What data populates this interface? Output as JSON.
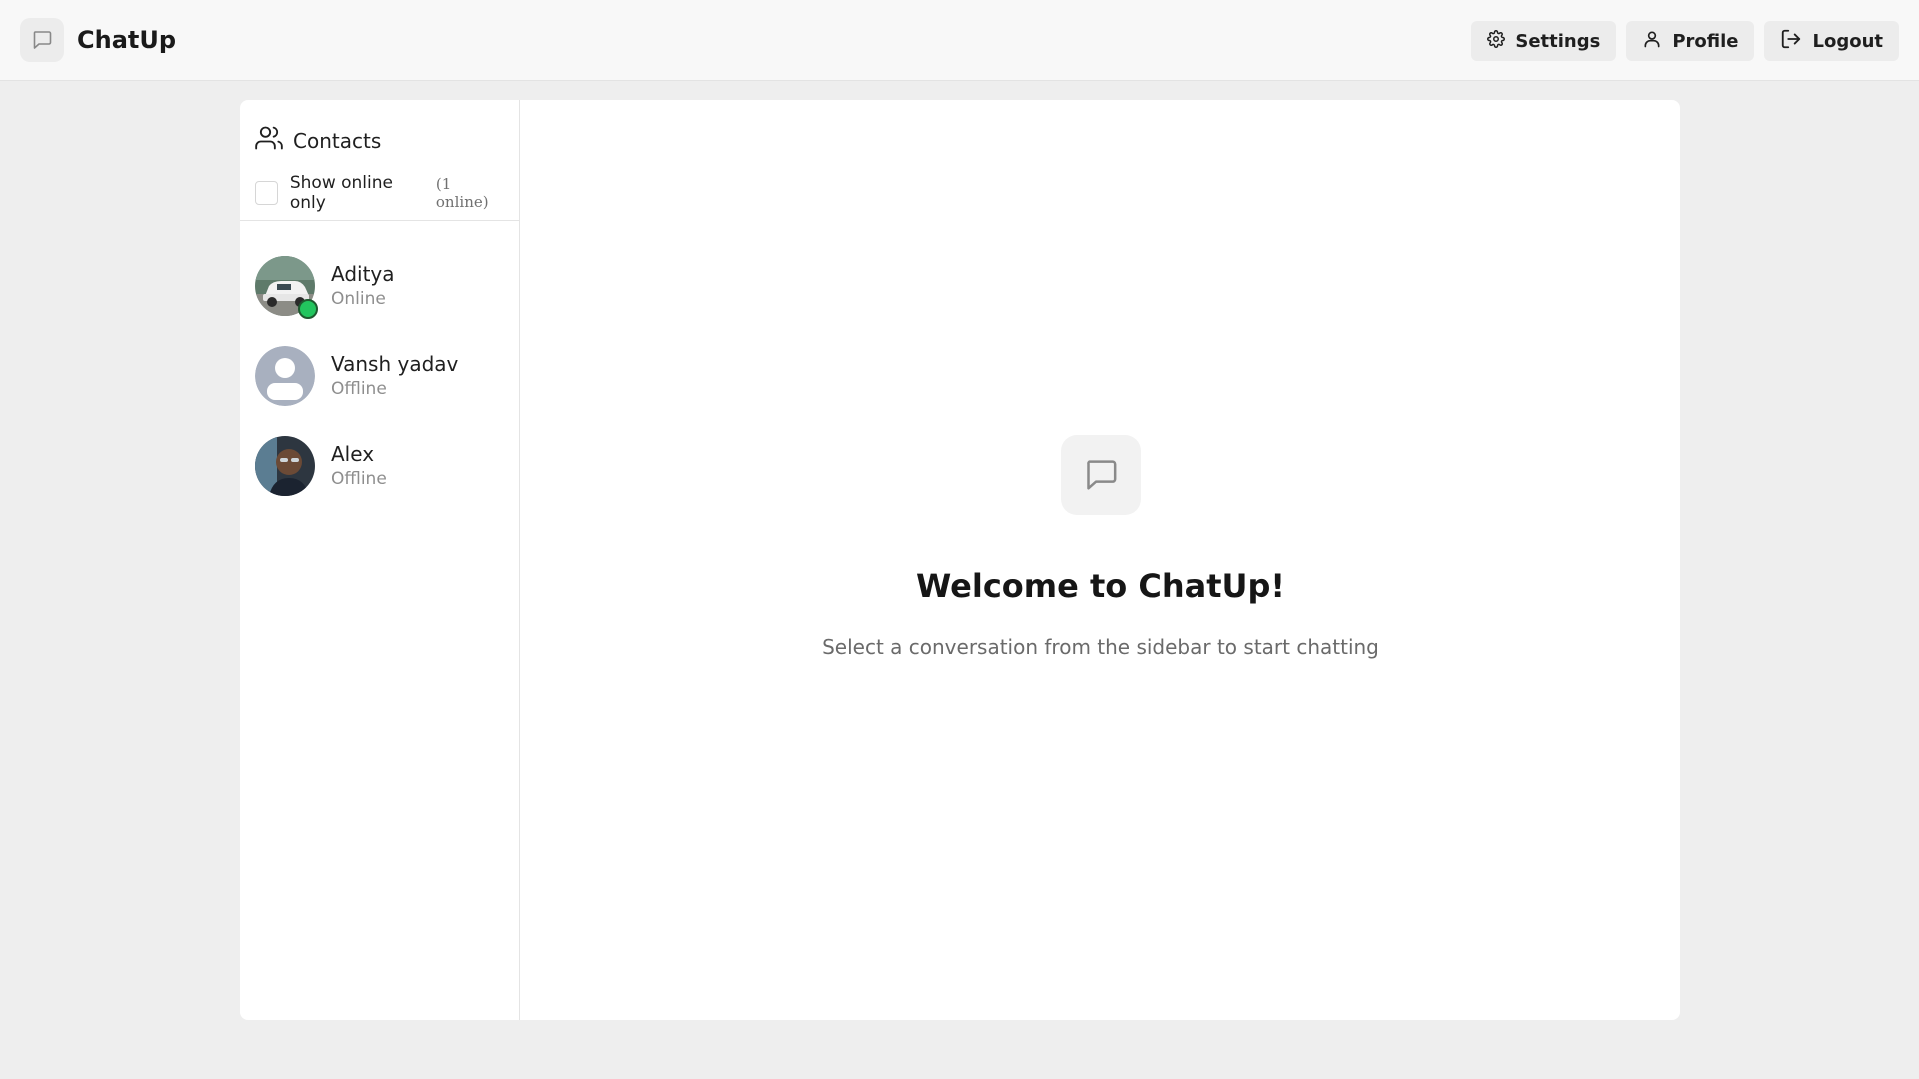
{
  "app": {
    "name": "ChatUp"
  },
  "nav": {
    "settings": "Settings",
    "profile": "Profile",
    "logout": "Logout"
  },
  "sidebar": {
    "title": "Contacts",
    "filter_label": "Show online only",
    "online_count": "(1 online)",
    "contacts": [
      {
        "name": "Aditya",
        "status": "Online"
      },
      {
        "name": "Vansh yadav",
        "status": "Offline"
      },
      {
        "name": "Alex",
        "status": "Offline"
      }
    ]
  },
  "main": {
    "welcome_title": "Welcome to ChatUp!",
    "welcome_subtitle": "Select a conversation from the sidebar to start chatting"
  },
  "colors": {
    "online": "#22c55e",
    "page_bg": "#eeeeee",
    "card_bg": "#ffffff"
  }
}
